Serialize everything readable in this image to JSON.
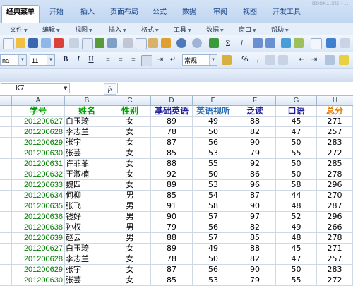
{
  "ribbon": {
    "tabs": [
      "经典菜单",
      "开始",
      "插入",
      "页面布局",
      "公式",
      "数据",
      "审阅",
      "视图",
      "开发工具"
    ],
    "active": 0,
    "title_partial": "Book1.xls - ..."
  },
  "menubar": {
    "items": [
      "文件",
      "编辑",
      "视图",
      "插入",
      "格式",
      "工具",
      "数据",
      "窗口",
      "帮助"
    ]
  },
  "toolbar2": {
    "font_name": "na",
    "font_size": "11",
    "bold": "B",
    "italic": "I",
    "underline": "U",
    "number_format": "常规",
    "percent": "%",
    "comma": ","
  },
  "formula_bar": {
    "name_box": "K7",
    "fx": "fx",
    "formula": ""
  },
  "columns": [
    "A",
    "B",
    "C",
    "D",
    "E",
    "F",
    "G",
    "H"
  ],
  "headers": {
    "labels": [
      "学号",
      "姓名",
      "性别",
      "基础英语",
      "英语视听",
      "泛读",
      "口语",
      "总分"
    ],
    "colors": [
      "#00a000",
      "#00a000",
      "#00a000",
      "#1f1f9f",
      "#2e6fb6",
      "#1f1f9f",
      "#1f1f9f",
      "#e07b00"
    ]
  },
  "rows": [
    [
      "201200627",
      "白玉琦",
      "女",
      "89",
      "49",
      "88",
      "45",
      "271"
    ],
    [
      "201200628",
      "李志兰",
      "女",
      "78",
      "50",
      "82",
      "47",
      "257"
    ],
    [
      "201200629",
      "张宇",
      "女",
      "87",
      "56",
      "90",
      "50",
      "283"
    ],
    [
      "201200630",
      "张芸",
      "女",
      "85",
      "53",
      "79",
      "55",
      "272"
    ],
    [
      "201200631",
      "许菲菲",
      "女",
      "88",
      "55",
      "92",
      "50",
      "285"
    ],
    [
      "201200632",
      "王淑楠",
      "女",
      "92",
      "50",
      "86",
      "50",
      "278"
    ],
    [
      "201200633",
      "魏四",
      "女",
      "89",
      "53",
      "96",
      "58",
      "296"
    ],
    [
      "201200634",
      "何柳",
      "男",
      "85",
      "54",
      "87",
      "44",
      "270"
    ],
    [
      "201200635",
      "张飞",
      "男",
      "91",
      "58",
      "90",
      "48",
      "287"
    ],
    [
      "201200636",
      "钱好",
      "男",
      "90",
      "57",
      "97",
      "52",
      "296"
    ],
    [
      "201200638",
      "孙权",
      "男",
      "79",
      "56",
      "82",
      "49",
      "266"
    ],
    [
      "201200639",
      "赵云",
      "男",
      "88",
      "57",
      "85",
      "48",
      "278"
    ],
    [
      "201200627",
      "白玉琦",
      "女",
      "89",
      "49",
      "88",
      "45",
      "271"
    ],
    [
      "201200628",
      "李志兰",
      "女",
      "78",
      "50",
      "82",
      "47",
      "257"
    ],
    [
      "201200629",
      "张宇",
      "女",
      "87",
      "56",
      "90",
      "50",
      "283"
    ],
    [
      "201200630",
      "张芸",
      "女",
      "85",
      "53",
      "79",
      "55",
      "272"
    ]
  ],
  "colors": {
    "id_text": "#008000",
    "body_text": "#000000"
  }
}
